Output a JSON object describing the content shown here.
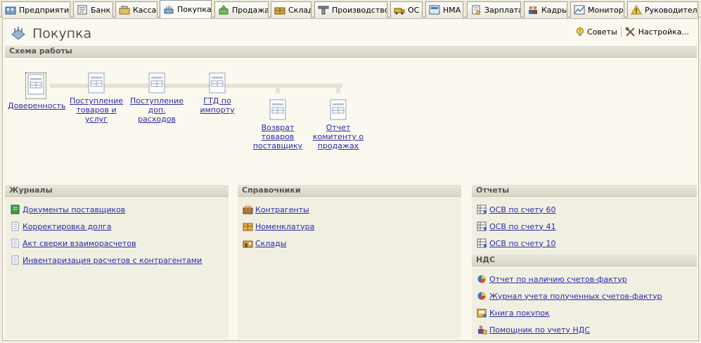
{
  "tabs": [
    {
      "label": "Предприятие",
      "icon": "enterprise-icon"
    },
    {
      "label": "Банк",
      "icon": "bank-icon"
    },
    {
      "label": "Касса",
      "icon": "cash-icon"
    },
    {
      "label": "Покупка",
      "icon": "purchase-icon",
      "active": true
    },
    {
      "label": "Продажа",
      "icon": "sale-icon"
    },
    {
      "label": "Склад",
      "icon": "warehouse-icon"
    },
    {
      "label": "Производство",
      "icon": "production-icon"
    },
    {
      "label": "ОС",
      "icon": "fixed-assets-icon"
    },
    {
      "label": "НМА",
      "icon": "intangible-assets-icon"
    },
    {
      "label": "Зарплата",
      "icon": "salary-icon"
    },
    {
      "label": "Кадры",
      "icon": "hr-icon"
    },
    {
      "label": "Монитор",
      "icon": "monitor-icon"
    },
    {
      "label": "Руководителю",
      "icon": "warning-icon"
    }
  ],
  "page": {
    "title": "Покупка"
  },
  "top_links": {
    "tips": "Советы",
    "settings": "Настройка..."
  },
  "schema": {
    "title": "Схема работы",
    "nodes": [
      {
        "label": "Доверенность"
      },
      {
        "label": "Поступление товаров и услуг"
      },
      {
        "label": "Поступление доп. расходов"
      },
      {
        "label": "ГТД по импорту"
      },
      {
        "label": "Возврат товаров поставщику"
      },
      {
        "label": "Отчет комитенту о продажах"
      }
    ]
  },
  "journals": {
    "title": "Журналы",
    "items": [
      {
        "label": "Документы поставщиков",
        "icon": "journal-icon"
      },
      {
        "label": "Корректировка долга",
        "icon": "document-icon"
      },
      {
        "label": "Акт сверки взаиморасчетов",
        "icon": "document-icon"
      },
      {
        "label": "Инвентаризация расчетов с контрагентами",
        "icon": "document-icon"
      }
    ]
  },
  "catalogs": {
    "title": "Справочники",
    "items": [
      {
        "label": "Контрагенты",
        "icon": "counterparties-icon"
      },
      {
        "label": "Номенклатура",
        "icon": "nomenclature-icon"
      },
      {
        "label": "Склады",
        "icon": "warehouses-icon"
      }
    ]
  },
  "reports": {
    "title": "Отчеты",
    "items": [
      {
        "label": "ОСВ по счету 60",
        "icon": "report-icon"
      },
      {
        "label": "ОСВ по счету 41",
        "icon": "report-icon"
      },
      {
        "label": "ОСВ по счету 10",
        "icon": "report-icon"
      }
    ]
  },
  "vat": {
    "title": "НДС",
    "items": [
      {
        "label": "Отчет по наличию счетов-фактур",
        "icon": "ball-report-icon"
      },
      {
        "label": "Журнал учета полученных счетов-фактур",
        "icon": "ball-report-icon"
      },
      {
        "label": "Книга покупок",
        "icon": "book-icon"
      },
      {
        "label": "Помощник по учету НДС",
        "icon": "assistant-icon"
      }
    ]
  },
  "colors": {
    "link": "#2a2aa8",
    "panel": "#f1efe2",
    "header": "#d9d6c6"
  }
}
